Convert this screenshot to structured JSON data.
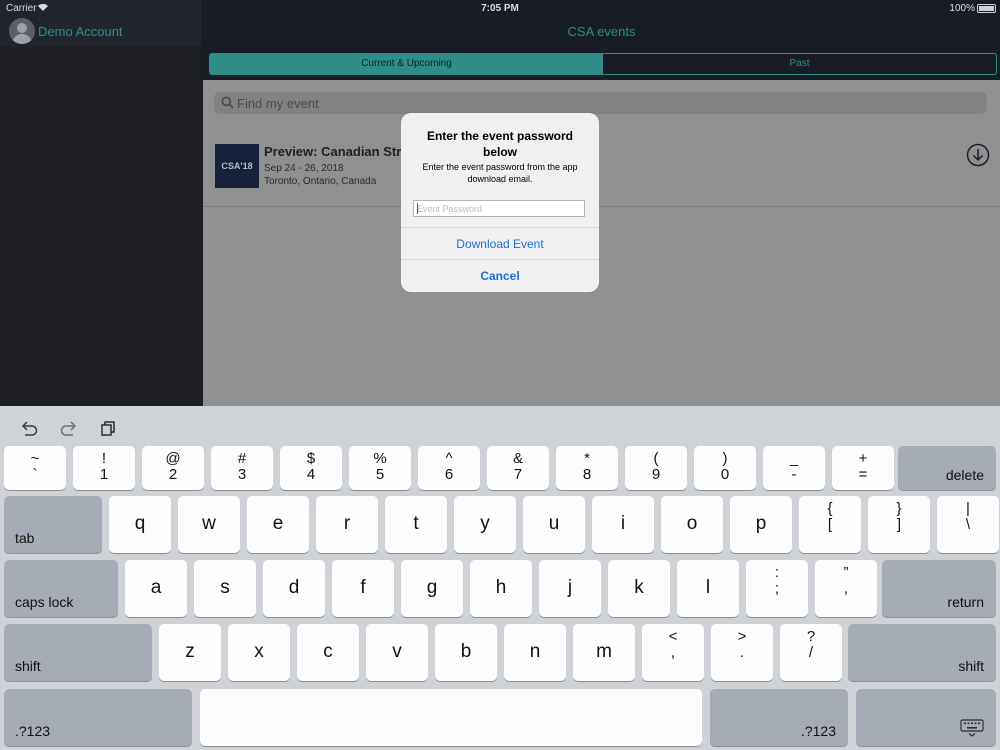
{
  "status_bar": {
    "carrier": "Carrier",
    "time": "7:05 PM",
    "battery": "100%"
  },
  "sidebar": {
    "account_name": "Demo Account"
  },
  "main": {
    "title": "CSA events",
    "tabs": [
      {
        "label": "Current & Upcoming",
        "selected": true
      },
      {
        "label": "Past",
        "selected": false
      }
    ],
    "search": {
      "placeholder": "Find my event"
    },
    "event": {
      "logo_text": "CSA'18",
      "title": "Preview: Canadian Stra",
      "dates": "Sep 24 - 26, 2018",
      "location": "Toronto, Ontario, Canada"
    }
  },
  "dialog": {
    "title": "Enter the event password below",
    "message": "Enter the event password from the app download email.",
    "password_placeholder": "Event Password",
    "download_label": "Download Event",
    "cancel_label": "Cancel"
  },
  "keyboard": {
    "toolbar_icons": [
      "undo-icon",
      "redo-icon",
      "paste-icon"
    ],
    "row1": [
      {
        "top": "~",
        "bot": "`"
      },
      {
        "top": "!",
        "bot": "1"
      },
      {
        "top": "@",
        "bot": "2"
      },
      {
        "top": "#",
        "bot": "3"
      },
      {
        "top": "$",
        "bot": "4"
      },
      {
        "top": "%",
        "bot": "5"
      },
      {
        "top": "^",
        "bot": "6"
      },
      {
        "top": "&",
        "bot": "7"
      },
      {
        "top": "*",
        "bot": "8"
      },
      {
        "top": "(",
        "bot": "9"
      },
      {
        "top": ")",
        "bot": "0"
      },
      {
        "top": "_",
        "bot": "-"
      },
      {
        "top": "+",
        "bot": "="
      }
    ],
    "delete": "delete",
    "tab": "tab",
    "row2": [
      "q",
      "w",
      "e",
      "r",
      "t",
      "y",
      "u",
      "i",
      "o",
      "p"
    ],
    "row2_sym": [
      {
        "top": "{",
        "bot": "["
      },
      {
        "top": "}",
        "bot": "]"
      },
      {
        "top": "|",
        "bot": "\\"
      }
    ],
    "caps_lock": "caps lock",
    "row3": [
      "a",
      "s",
      "d",
      "f",
      "g",
      "h",
      "j",
      "k",
      "l"
    ],
    "row3_sym": [
      {
        "top": ":",
        "bot": ";"
      },
      {
        "top": "”",
        "bot": ","
      }
    ],
    "return": "return",
    "shift": "shift",
    "row4": [
      "z",
      "x",
      "c",
      "v",
      "b",
      "n",
      "m"
    ],
    "row4_sym": [
      {
        "top": "<",
        "bot": ","
      },
      {
        "top": ">",
        "bot": "."
      },
      {
        "top": "?",
        "bot": "/"
      }
    ],
    "numbers": ".?123"
  }
}
